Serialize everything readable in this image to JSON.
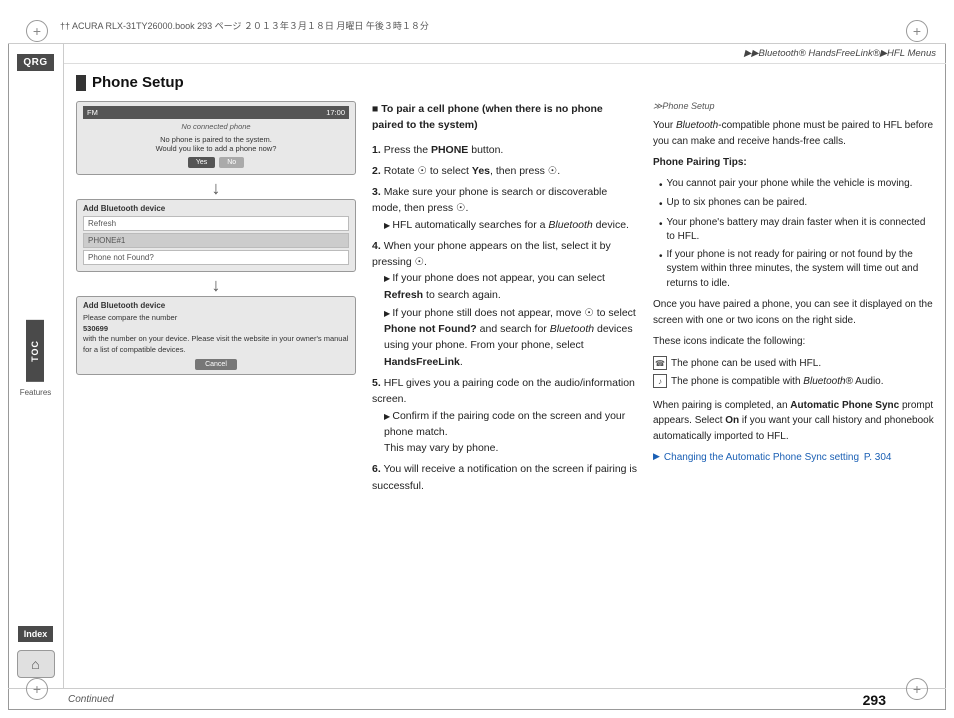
{
  "page": {
    "title": "Phone Setup",
    "page_number": "293",
    "continued": "Continued"
  },
  "header": {
    "file_info": "†† ACURA RLX-31TY26000.book  293 ページ  ２０１３年３月１８日  月曜日  午後３時１８分",
    "breadcrumb": "▶▶Bluetooth® HandsFreeLink®▶HFL Menus"
  },
  "sidebar": {
    "qrg": "QRG",
    "toc": "TOC",
    "toc_sublabel": "Features",
    "index": "Index",
    "home": "⌂"
  },
  "left_column": {
    "screen1": {
      "header_left": "FM",
      "header_right": "17:00",
      "subtitle": "No connected phone",
      "body": "No phone is paired to the system.\nWould you like to add a phone now?",
      "btn_yes": "Yes",
      "btn_no": "No"
    },
    "screen2": {
      "title": "Add Bluetooth device",
      "item1": "Refresh",
      "item2": "PHONE#1",
      "item3": "Phone not Found?"
    },
    "screen3": {
      "title": "Add Bluetooth device",
      "body": "Please compare the number\n530699\nwith the number on your device. Please visit the\nwebsite in your owner's manual\nfor a list of compatible devices.",
      "cancel_btn": "Cancel"
    }
  },
  "instructions": {
    "heading": "■ To pair a cell phone (when there is no phone paired to the system)",
    "steps": [
      {
        "num": "1.",
        "text": "Press the PHONE button."
      },
      {
        "num": "2.",
        "text": "Rotate ⊙ to select Yes, then press ⊙."
      },
      {
        "num": "3.",
        "text": "Make sure your phone is search or discoverable mode, then press ⊙.",
        "sub": "HFL automatically searches for a Bluetooth device."
      },
      {
        "num": "4.",
        "text": "When your phone appears on the list, select it by pressing ⊙.",
        "subs": [
          "If your phone does not appear, you can select Refresh to search again.",
          "If your phone still does not appear, move ⊙ to select Phone not Found? and search for Bluetooth devices using your phone. From your phone, select HandsFreeLink."
        ]
      },
      {
        "num": "5.",
        "text": "HFL gives you a pairing code on the audio/information screen.",
        "sub": "Confirm if the pairing code on the screen and your phone match.\nThis may vary by phone."
      },
      {
        "num": "6.",
        "text": "You will receive a notification on the screen if pairing is successful."
      }
    ]
  },
  "right_column": {
    "section_label": "≫Phone Setup",
    "intro": "Your Bluetooth-compatible phone must be paired to HFL before you can make and receive hands-free calls.",
    "pairing_tips_title": "Phone Pairing Tips:",
    "tips": [
      "You cannot pair your phone while the vehicle is moving.",
      "Up to six phones can be paired.",
      "Your phone's battery may drain faster when it is connected to HFL.",
      "If your phone is not ready for pairing or not found by the system within three minutes, the system will time out and returns to idle."
    ],
    "post_pairing": "Once you have paired a phone, you can see it displayed on the screen with one or two icons on the right side.",
    "icons_intro": "These icons indicate the following:",
    "icon1_text": "The phone can be used with HFL.",
    "icon2_text": "The phone is compatible with Bluetooth® Audio.",
    "auto_sync_intro": "When pairing is completed, an Automatic Phone Sync prompt appears. Select On if you want your call history and phonebook automatically imported to HFL.",
    "link_text": "Changing the Automatic Phone Sync setting",
    "link_page": "P. 304"
  }
}
